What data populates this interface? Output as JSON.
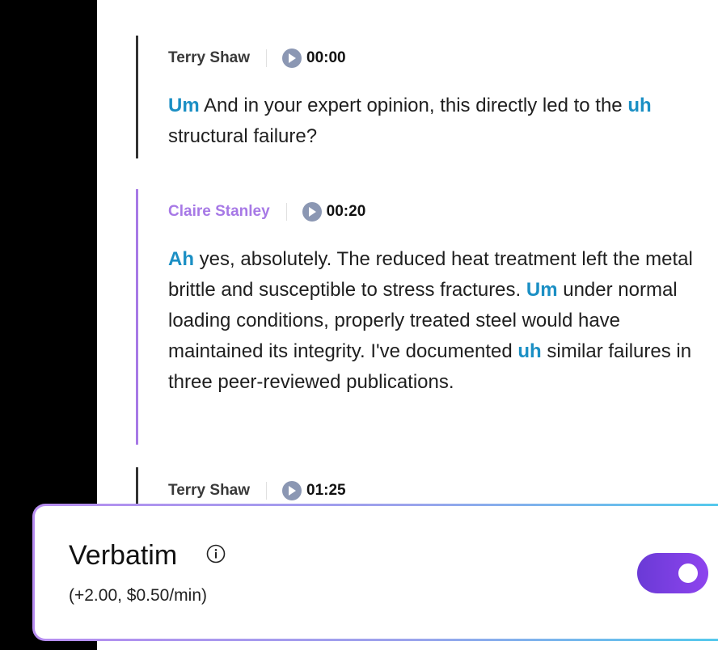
{
  "transcript": [
    {
      "speaker": "Terry Shaw",
      "speaker_color": "#3a3a3a",
      "timestamp": "00:00",
      "text": [
        {
          "t": "Um",
          "filler": true
        },
        {
          "t": " And in your expert opinion, this directly led to the ",
          "filler": false
        },
        {
          "t": "uh",
          "filler": true
        },
        {
          "t": " structural failure?",
          "filler": false
        }
      ]
    },
    {
      "speaker": "Claire Stanley",
      "speaker_color": "#a779e6",
      "timestamp": "00:20",
      "text": [
        {
          "t": "Ah",
          "filler": true
        },
        {
          "t": " yes, absolutely. The reduced heat treatment left the metal brittle and susceptible to stress fractures. ",
          "filler": false
        },
        {
          "t": "Um",
          "filler": true
        },
        {
          "t": " under normal loading conditions, properly treated steel would have maintained its integrity. I've documented ",
          "filler": false
        },
        {
          "t": "uh",
          "filler": true
        },
        {
          "t": " similar failures in three peer-reviewed publications.",
          "filler": false
        }
      ]
    },
    {
      "speaker": "Terry Shaw",
      "speaker_color": "#3a3a3a",
      "timestamp": "01:25",
      "text": []
    }
  ],
  "option": {
    "title": "Verbatim",
    "subtitle": "(+2.00, $0.50/min)",
    "info_icon": "info-circle-icon",
    "enabled": true,
    "toggle_color": "#7b3fe4"
  },
  "colors": {
    "filler": "#1b8fc4",
    "play_button": "#8b97b3"
  }
}
